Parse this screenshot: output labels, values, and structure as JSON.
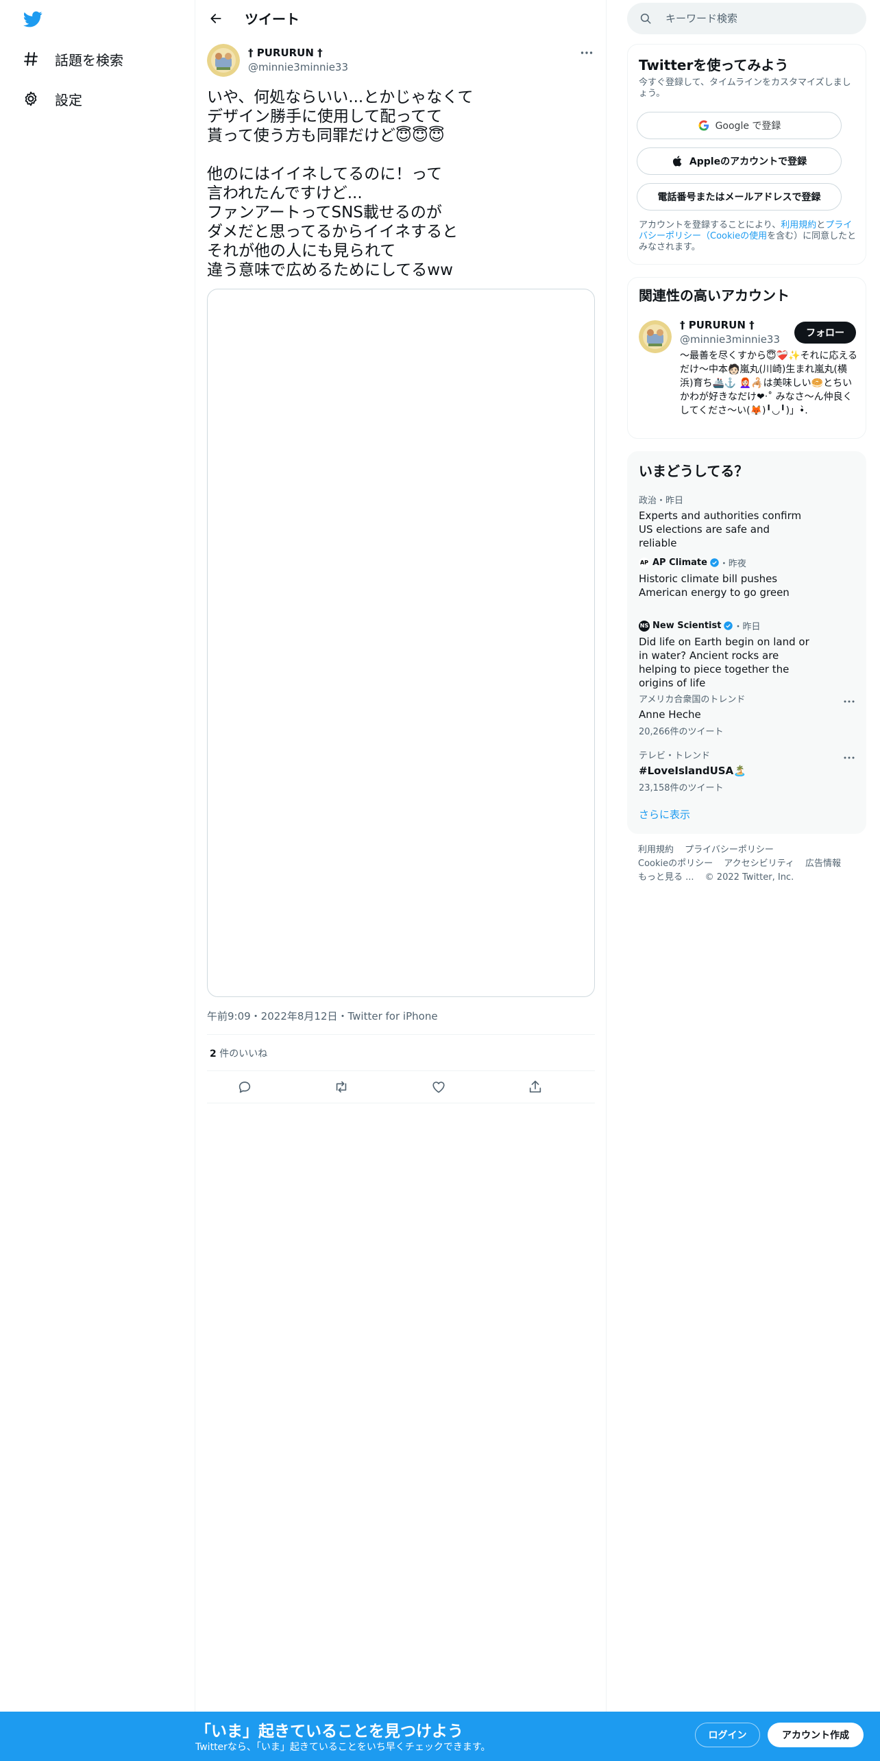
{
  "nav": {
    "logo_icon": "twitter-bird-icon",
    "items": [
      {
        "label": "話題を検索",
        "icon": "hashtag-icon"
      },
      {
        "label": "設定",
        "icon": "gear-icon"
      }
    ]
  },
  "header": {
    "title": "ツイート",
    "back_icon": "back-arrow-icon"
  },
  "tweet": {
    "author_name": "† PURURUN †",
    "author_handle": "@minnie3minnie33",
    "text": "いや、何処ならいい...とかじゃなくて\nデザイン勝手に使用して配ってて\n貰って使う方も同罪だけど😇😇😇\n\n他のにはイイネしてるのに！って\n言われたんですけど...\nファンアートってSNS載せるのが\nダメだと思ってるからイイネすると\nそれが他の人にも見られて\n違う意味で広めるためにしてるww",
    "meta": "午前9:09・2022年8月12日・Twitter for iPhone",
    "likes_count": "2",
    "likes_label": " 件のいいね"
  },
  "search": {
    "placeholder": "キーワード検索"
  },
  "signup_panel": {
    "title": "Twitterを使ってみよう",
    "subtitle": "今すぐ登録して、タイムラインをカスタマイズしましょう。",
    "google_label": "Google で登録",
    "apple_label": "Appleのアカウントで登録",
    "phone_label": "電話番号またはメールアドレスで登録",
    "legal_prefix": "アカウントを登録することにより、",
    "legal_link1": "利用規約",
    "legal_mid": "と",
    "legal_link2": "プライバシーポリシー（Cookieの使用",
    "legal_suffix": "を含む）に同意したとみなされます。"
  },
  "related_panel": {
    "title": "関連性の高いアカウント",
    "name": "† PURURUN †",
    "handle": "@minnie3minnie33",
    "follow_label": "フォロー",
    "bio": "〜最善を尽くすから😇❤️‍🩹✨それに応えるだけ〜中本🧑🏻嵐丸(川崎)生まれ嵐丸(横浜)育ち🚢⚓️ 👩🏻‍🦰🦂は美味しい🥯とちいかわが好きなだけ❤︎‧˚ みなさ〜ん仲良くしてくださ〜い(🦊)╹◡╹)」•̀."
  },
  "trends_panel": {
    "title": "いまどうしてる？",
    "items": [
      {
        "context": "政治・昨日",
        "title": "Experts and authorities confirm US elections are safe and reliable"
      },
      {
        "source": "AP Climate",
        "time": "・昨夜",
        "title": "Historic climate bill pushes American energy to go green"
      },
      {
        "source": "New Scientist",
        "time": "・昨日",
        "title": "Did life on Earth begin on land or in water? Ancient rocks are helping to piece together the origins of life"
      },
      {
        "context": "アメリカ合衆国のトレンド",
        "title": "Anne Heche",
        "count": "20,266件のツイート"
      },
      {
        "context": "テレビ・トレンド",
        "title": "#LoveIslandUSA🏝️",
        "count": "23,158件のツイート"
      }
    ],
    "show_more": "さらに表示"
  },
  "footer": {
    "links": [
      "利用規約",
      "プライバシーポリシー",
      "Cookieのポリシー",
      "アクセシビリティ",
      "広告情報",
      "もっと見る ...",
      "© 2022 Twitter, Inc."
    ]
  },
  "bottom_bar": {
    "title": "「いま」起きていることを見つけよう",
    "subtitle": "Twitterなら、「いま」起きていることをいち早くチェックできます。",
    "login_label": "ログイン",
    "signup_label": "アカウント作成"
  },
  "colors": {
    "accent": "#1d9bf0",
    "text": "#0f1419",
    "muted": "#536471",
    "border": "#eff3f4"
  }
}
